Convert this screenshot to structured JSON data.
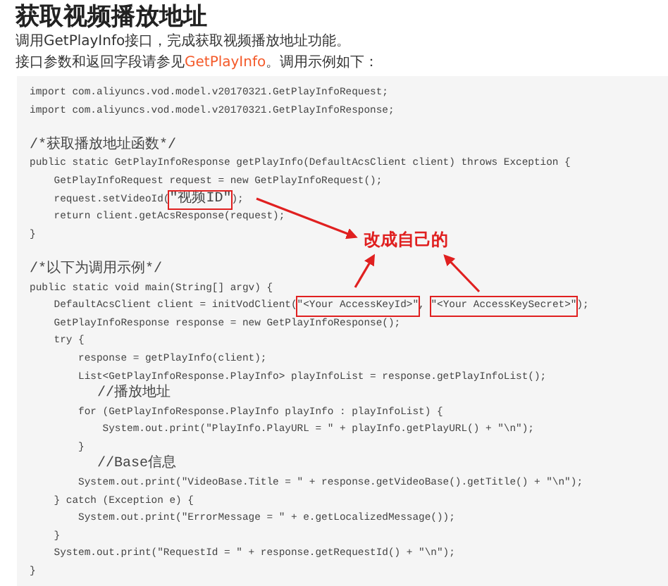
{
  "title": "获取视频播放地址",
  "intro": [
    [
      {
        "kind": "text",
        "text": "调用GetPlayInfo接口，完成获取视频播放地址功能。"
      }
    ],
    [
      {
        "kind": "text",
        "text": "接口参数和返回字段请参见"
      },
      {
        "kind": "link",
        "text": "GetPlayInfo"
      },
      {
        "kind": "text",
        "text": "。调用示例如下："
      }
    ]
  ],
  "code": [
    [
      {
        "text": "import com.aliyuncs.vod.model.v20170321.GetPlayInfoRequest;",
        "boxed": false
      }
    ],
    [
      {
        "text": "import com.aliyuncs.vod.model.v20170321.GetPlayInfoResponse;",
        "boxed": false
      }
    ],
    [
      {
        "text": "/*获取播放地址函数*/",
        "boxed": false,
        "gap_before": true
      }
    ],
    [
      {
        "text": "public static GetPlayInfoResponse getPlayInfo(DefaultAcsClient client) throws Exception {",
        "boxed": false
      }
    ],
    [
      {
        "text": "    GetPlayInfoRequest request = new GetPlayInfoRequest();",
        "boxed": false
      }
    ],
    [
      {
        "text": "    request.setVideoId(",
        "boxed": false
      },
      {
        "text": "\"视频ID\"",
        "boxed": true
      },
      {
        "text": ");",
        "boxed": false
      }
    ],
    [
      {
        "text": "    return client.getAcsResponse(request);",
        "boxed": false
      }
    ],
    [
      {
        "text": "}",
        "boxed": false
      }
    ],
    [
      {
        "text": "/*以下为调用示例*/",
        "boxed": false,
        "gap_before": true
      }
    ],
    [
      {
        "text": "public static void main(String[] argv) {",
        "boxed": false
      }
    ],
    [
      {
        "text": "    DefaultAcsClient client = initVodClient(",
        "boxed": false
      },
      {
        "text": "\"<Your AccessKeyId>\"",
        "boxed": true
      },
      {
        "text": ", ",
        "boxed": false
      },
      {
        "text": "\"<Your AccessKeySecret>\"",
        "boxed": true
      },
      {
        "text": ");",
        "boxed": false
      }
    ],
    [
      {
        "text": "    GetPlayInfoResponse response = new GetPlayInfoResponse();",
        "boxed": false
      }
    ],
    [
      {
        "text": "    try {",
        "boxed": false
      }
    ],
    [
      {
        "text": "        response = getPlayInfo(client);",
        "boxed": false
      }
    ],
    [
      {
        "text": "        List<GetPlayInfoResponse.PlayInfo> playInfoList = response.getPlayInfoList();",
        "boxed": false
      }
    ],
    [
      {
        "text": "        //播放地址",
        "boxed": false
      }
    ],
    [
      {
        "text": "        for (GetPlayInfoResponse.PlayInfo playInfo : playInfoList) {",
        "boxed": false
      }
    ],
    [
      {
        "text": "            System.out.print(\"PlayInfo.PlayURL = \" + playInfo.getPlayURL() + \"\\n\");",
        "boxed": false
      }
    ],
    [
      {
        "text": "        }",
        "boxed": false
      }
    ],
    [
      {
        "text": "        //Base信息",
        "boxed": false
      }
    ],
    [
      {
        "text": "        System.out.print(\"VideoBase.Title = \" + response.getVideoBase().getTitle() + \"\\n\");",
        "boxed": false
      }
    ],
    [
      {
        "text": "    } catch (Exception e) {",
        "boxed": false
      }
    ],
    [
      {
        "text": "        System.out.print(\"ErrorMessage = \" + e.getLocalizedMessage());",
        "boxed": false
      }
    ],
    [
      {
        "text": "    }",
        "boxed": false
      }
    ],
    [
      {
        "text": "    System.out.print(\"RequestId = \" + response.getRequestId() + \"\\n\");",
        "boxed": false
      }
    ],
    [
      {
        "text": "}",
        "boxed": false
      }
    ]
  ],
  "annotation": {
    "text": "改成自己的"
  }
}
